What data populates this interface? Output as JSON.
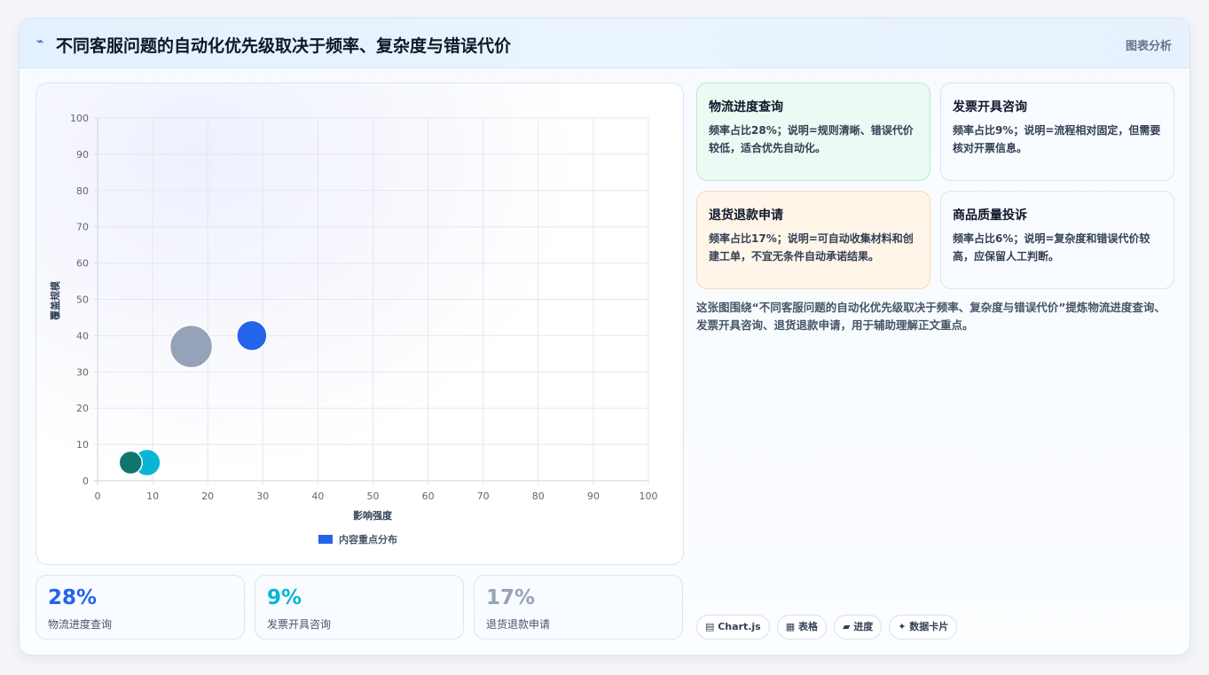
{
  "header": {
    "icon": "⌁",
    "title": "不同客服问题的自动化优先级取决于频率、复杂度与错误代价",
    "tag": "图表分析"
  },
  "chart_data": {
    "type": "bubble",
    "xlabel": "影响强度",
    "ylabel": "覆盖规模",
    "xlim": [
      0,
      100
    ],
    "ylim": [
      0,
      100
    ],
    "xticks": [
      "0",
      "10",
      "20",
      "30",
      "40",
      "50",
      "60",
      "70",
      "80",
      "90",
      "100"
    ],
    "yticks": [
      "0",
      "10",
      "20",
      "30",
      "40",
      "50",
      "60",
      "70",
      "80",
      "90",
      "100"
    ],
    "grid": true,
    "legend": {
      "position": "bottom",
      "label": "内容重点分布",
      "color": "#2563eb"
    },
    "points": [
      {
        "x": 28,
        "y": 40,
        "r": 17,
        "color": "#2563eb"
      },
      {
        "x": 9,
        "y": 5,
        "r": 15,
        "color": "#06b6d4"
      },
      {
        "x": 17,
        "y": 37,
        "r": 24,
        "color": "#94a3b8"
      },
      {
        "x": 6,
        "y": 5,
        "r": 13,
        "color": "#0f766e"
      }
    ]
  },
  "stats": [
    {
      "value": "28%",
      "label": "物流进度查询",
      "color": "#2563eb"
    },
    {
      "value": "9%",
      "label": "发票开具咨询",
      "color": "#06b6d4"
    },
    {
      "value": "17%",
      "label": "退货退款申请",
      "color": "#94a3b8"
    }
  ],
  "info_cards": [
    {
      "title": "物流进度查询",
      "desc": "频率占比28%；说明=规则清晰、错误代价较低，适合优先自动化。"
    },
    {
      "title": "发票开具咨询",
      "desc": "频率占比9%；说明=流程相对固定，但需要核对开票信息。"
    },
    {
      "title": "退货退款申请",
      "desc": "频率占比17%；说明=可自动收集材料和创建工单，不宜无条件自动承诺结果。"
    },
    {
      "title": "商品质量投诉",
      "desc": "频率占比6%；说明=复杂度和错误代价较高，应保留人工判断。"
    }
  ],
  "summary": "这张图围绕“不同客服问题的自动化优先级取决于频率、复杂度与错误代价”提炼物流进度查询、发票开具咨询、退货退款申请，用于辅助理解正文重点。",
  "pills": [
    "▤ Chart.js",
    "▦ 表格",
    "▰ 进度",
    "✦ 数据卡片"
  ]
}
